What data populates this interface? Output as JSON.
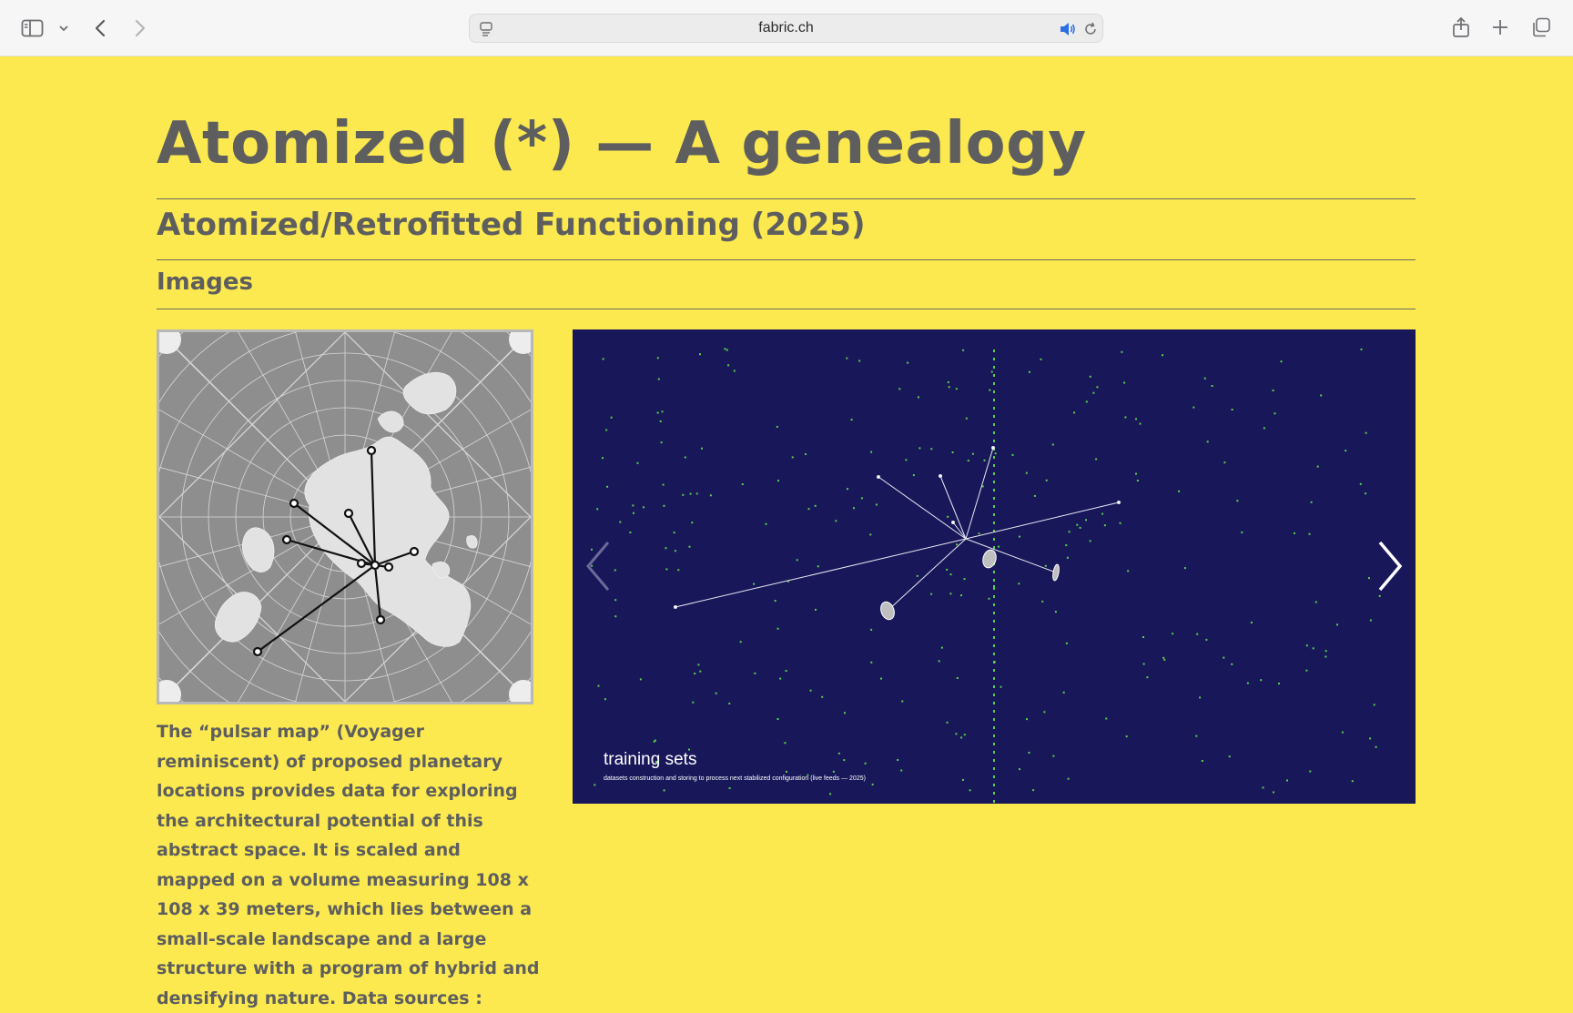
{
  "browser": {
    "url": "fabric.ch"
  },
  "page": {
    "title": "Atomized (*) — A genealogy",
    "subtitle": "Atomized/Retrofitted Functioning (2025)",
    "section": "Images",
    "description": "The “pulsar map” (Voyager reminiscent) of proposed planetary locations provides data for exploring the architectural potential of this abstract space. It is scaled and mapped on a volume measuring 108 x 108 x 39 meters, which lies between a small-scale landscape and a large structure with a program of hybrid and densifying nature. Data sources :",
    "slide": {
      "caption_title": "training sets",
      "caption_subtitle": "datasets construction and storing to process next stabilized configuration (live feeds — 2025)"
    }
  },
  "colors": {
    "background": "#fbe94f",
    "text": "#5e5e5e",
    "slide_background": "#18175a",
    "dots": "#58d24a"
  }
}
